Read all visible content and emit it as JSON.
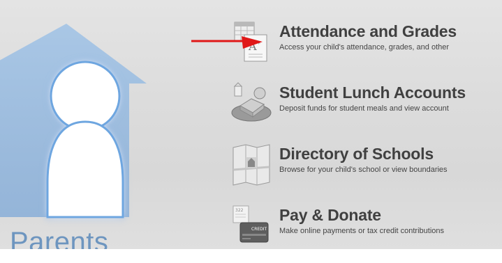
{
  "sidebar": {
    "label": "Parents",
    "icon": "parent-home-icon",
    "accent_color": "#6d95bf"
  },
  "items": [
    {
      "title": "Attendance and Grades",
      "description": "Access your child's attendance, grades, and other",
      "icon": "report-card-icon"
    },
    {
      "title": "Student Lunch Accounts",
      "description": "Deposit funds for student meals and view account",
      "icon": "lunch-tray-icon"
    },
    {
      "title": "Directory of Schools",
      "description": "Browse for your child's school or view boundaries",
      "icon": "map-icon"
    },
    {
      "title": "Pay & Donate",
      "description": "Make online payments or tax credit contributions",
      "icon": "credit-card-icon",
      "icon_text": {
        "card_label": "CREDIT",
        "receipt_number": "322"
      }
    }
  ],
  "annotation": {
    "icon": "red-arrow-icon",
    "color": "#e01818"
  }
}
